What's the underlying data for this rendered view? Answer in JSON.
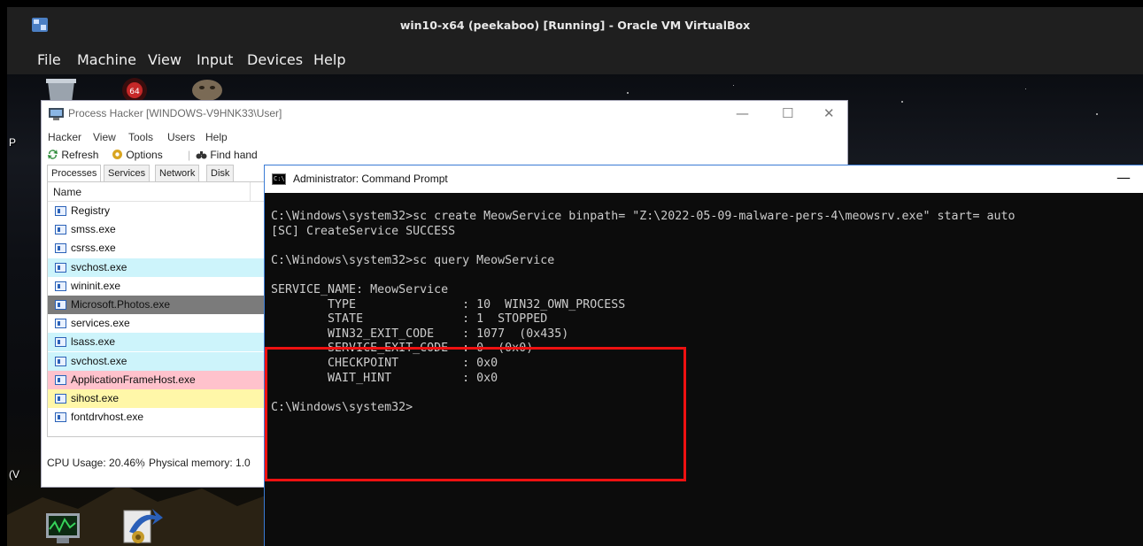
{
  "vbox": {
    "title": "win10-x64 (peekaboo) [Running] - Oracle VM VirtualBox",
    "menu": [
      "File",
      "Machine",
      "View",
      "Input",
      "Devices",
      "Help"
    ]
  },
  "process_hacker": {
    "title": "Process Hacker [WINDOWS-V9HNK33\\User]",
    "window_buttons": [
      "—",
      "☐",
      "✕"
    ],
    "menu": [
      "Hacker",
      "View",
      "Tools",
      "Users",
      "Help"
    ],
    "toolbar": {
      "refresh": "Refresh",
      "options": "Options",
      "find_handles": "Find hand"
    },
    "tabs": [
      "Processes",
      "Services",
      "Network",
      "Disk"
    ],
    "column_name": "Name",
    "processes": [
      {
        "name": "Registry",
        "color": "#ffffff"
      },
      {
        "name": "smss.exe",
        "color": "#ffffff"
      },
      {
        "name": "csrss.exe",
        "color": "#ffffff"
      },
      {
        "name": "svchost.exe",
        "color": "#cdf4fb"
      },
      {
        "name": "wininit.exe",
        "color": "#ffffff"
      },
      {
        "name": "Microsoft.Photos.exe",
        "color": "#7b7b7b"
      },
      {
        "name": "services.exe",
        "color": "#ffffff"
      },
      {
        "name": "lsass.exe",
        "color": "#cdf4fb"
      },
      {
        "name": "svchost.exe",
        "color": "#cdf4fb"
      },
      {
        "name": "ApplicationFrameHost.exe",
        "color": "#ffc2cc"
      },
      {
        "name": "sihost.exe",
        "color": "#fff7a8"
      },
      {
        "name": "fontdrvhost.exe",
        "color": "#ffffff"
      }
    ],
    "status": {
      "cpu": "CPU Usage: 20.46%",
      "memory": "Physical memory: 1.0"
    }
  },
  "cmd": {
    "title": "Administrator: Command Prompt",
    "minimize": "—",
    "icon_text": "C:\\",
    "lines": [
      "C:\\Windows\\system32>sc create MeowService binpath= \"Z:\\2022-05-09-malware-pers-4\\meowsrv.exe\" start= auto",
      "[SC] CreateService SUCCESS",
      "",
      "C:\\Windows\\system32>sc query MeowService",
      "",
      "SERVICE_NAME: MeowService",
      "        TYPE               : 10  WIN32_OWN_PROCESS",
      "        STATE              : 1  STOPPED",
      "        WIN32_EXIT_CODE    : 1077  (0x435)",
      "        SERVICE_EXIT_CODE  : 0  (0x0)",
      "        CHECKPOINT         : 0x0",
      "        WAIT_HINT          : 0x0",
      "",
      "C:\\Windows\\system32>"
    ]
  },
  "colors": {
    "highlight_border": "#ee1111",
    "cmd_bg": "#0c0c0c",
    "cmd_text": "#cccccc"
  }
}
